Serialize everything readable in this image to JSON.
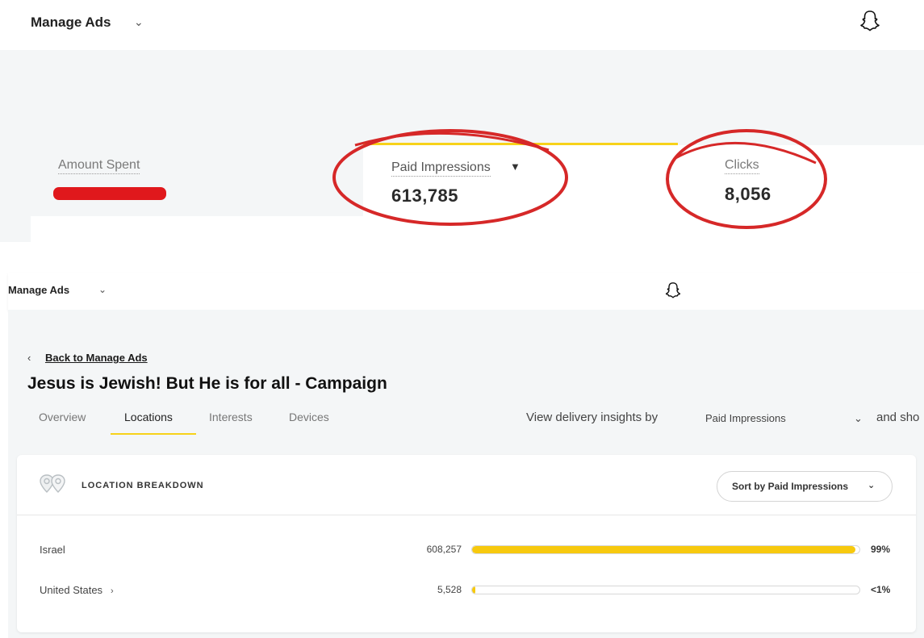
{
  "top": {
    "header": {
      "title": "Manage Ads",
      "chevron": "⌄"
    },
    "metrics": {
      "amount_spent": {
        "label": "Amount Spent"
      },
      "paid_impressions": {
        "label": "Paid Impressions",
        "caret": "▼",
        "value": "613,785"
      },
      "clicks": {
        "label": "Clicks",
        "value": "8,056"
      }
    }
  },
  "bottom": {
    "header": {
      "title": "Manage Ads",
      "chevron": "⌄"
    },
    "back": {
      "arrow": "‹",
      "label": "Back to Manage Ads"
    },
    "campaign_title": "Jesus is Jewish! But He is for all - Campaign",
    "tabs": [
      {
        "label": "Overview"
      },
      {
        "label": "Locations"
      },
      {
        "label": "Interests"
      },
      {
        "label": "Devices"
      }
    ],
    "active_tab": "Locations",
    "insights": {
      "prefix": "View delivery insights by",
      "selected": "Paid Impressions",
      "chevron": "⌄",
      "suffix": "and sho"
    },
    "location_card": {
      "title": "LOCATION BREAKDOWN",
      "sort_label": "Sort by Paid Impressions",
      "sort_chevron": "⌄",
      "rows": [
        {
          "name": "Israel",
          "value": "608,257",
          "fraction": 0.99,
          "pct": "99%",
          "has_arrow": false
        },
        {
          "name": "United States",
          "value": "5,528",
          "fraction": 0.009,
          "pct": "<1%",
          "has_arrow": true,
          "arrow": "›"
        }
      ]
    }
  },
  "colors": {
    "accent_yellow": "#f7d21a",
    "bar_fill": "#f7c90e",
    "annotation_red": "#d62828",
    "redaction_red": "#e0181c",
    "panel_gray": "#f4f6f7"
  },
  "icons": {
    "top_header": "snapchat-ghost-icon",
    "bottom_header": "snapchat-ghost-icon",
    "location_card": "location-pins-icon"
  }
}
